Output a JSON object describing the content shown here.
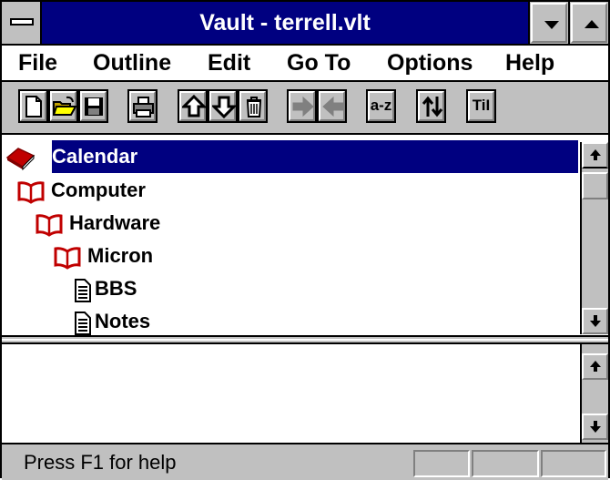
{
  "window": {
    "title": "Vault - terrell.vlt"
  },
  "menu": [
    {
      "label": "File"
    },
    {
      "label": "Outline"
    },
    {
      "label": "Edit"
    },
    {
      "label": "Go To"
    },
    {
      "label": "Options"
    },
    {
      "label": "Help"
    }
  ],
  "toolbar": {
    "sort_label": "a-z",
    "text_label": "TiI"
  },
  "outline": {
    "items": [
      {
        "label": "Calendar",
        "icon": "closed-book-icon",
        "selected": true
      },
      {
        "label": "Computer",
        "icon": "open-book-icon"
      },
      {
        "label": "Hardware",
        "icon": "open-book-icon"
      },
      {
        "label": "Micron",
        "icon": "open-book-icon"
      },
      {
        "label": "BBS",
        "icon": "document-icon"
      },
      {
        "label": "Notes",
        "icon": "document-icon"
      }
    ]
  },
  "status": {
    "text": "Press F1 for help"
  },
  "colors": {
    "title_bar": "#000080",
    "selection": "#000080",
    "face": "#c0c0c0",
    "book_red": "#c00000"
  }
}
